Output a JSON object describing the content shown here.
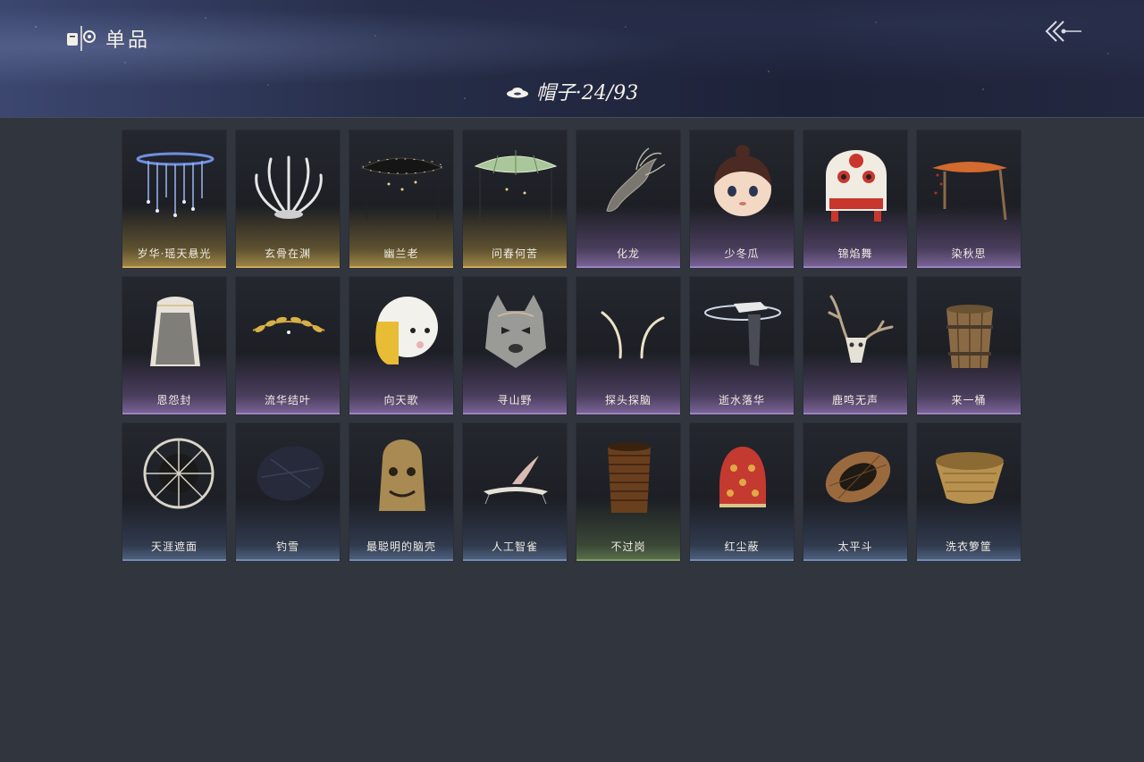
{
  "header": {
    "title": "单品",
    "title_icon": "wardrobe-icon",
    "back_icon": "back-arrow-icon"
  },
  "category": {
    "icon": "hat-icon",
    "label": "帽子·24/93"
  },
  "colors": {
    "gold": "#c9a85a",
    "purple": "#9b83c2",
    "blue": "#6f8bb6",
    "green": "#7f9d63"
  },
  "items": [
    {
      "name": "岁华·瑶天悬光",
      "rarity": "gold"
    },
    {
      "name": "玄骨在渊",
      "rarity": "gold"
    },
    {
      "name": "幽兰老",
      "rarity": "gold"
    },
    {
      "name": "问春何苦",
      "rarity": "gold"
    },
    {
      "name": "化龙",
      "rarity": "purple"
    },
    {
      "name": "少冬瓜",
      "rarity": "purple"
    },
    {
      "name": "锦焰舞",
      "rarity": "purple"
    },
    {
      "name": "染秋思",
      "rarity": "purple"
    },
    {
      "name": "恩怨封",
      "rarity": "purple"
    },
    {
      "name": "流华结叶",
      "rarity": "purple"
    },
    {
      "name": "向天歌",
      "rarity": "purple"
    },
    {
      "name": "寻山野",
      "rarity": "purple"
    },
    {
      "name": "探头探脑",
      "rarity": "purple"
    },
    {
      "name": "逝水落华",
      "rarity": "purple"
    },
    {
      "name": "鹿鸣无声",
      "rarity": "purple"
    },
    {
      "name": "来一桶",
      "rarity": "purple"
    },
    {
      "name": "天涯遮面",
      "rarity": "blue"
    },
    {
      "name": "钓雪",
      "rarity": "blue"
    },
    {
      "name": "最聪明的脑壳",
      "rarity": "blue"
    },
    {
      "name": "人工智雀",
      "rarity": "blue"
    },
    {
      "name": "不过岗",
      "rarity": "green"
    },
    {
      "name": "红尘蔽",
      "rarity": "blue"
    },
    {
      "name": "太平斗",
      "rarity": "blue"
    },
    {
      "name": "洗衣箩筐",
      "rarity": "blue"
    }
  ]
}
